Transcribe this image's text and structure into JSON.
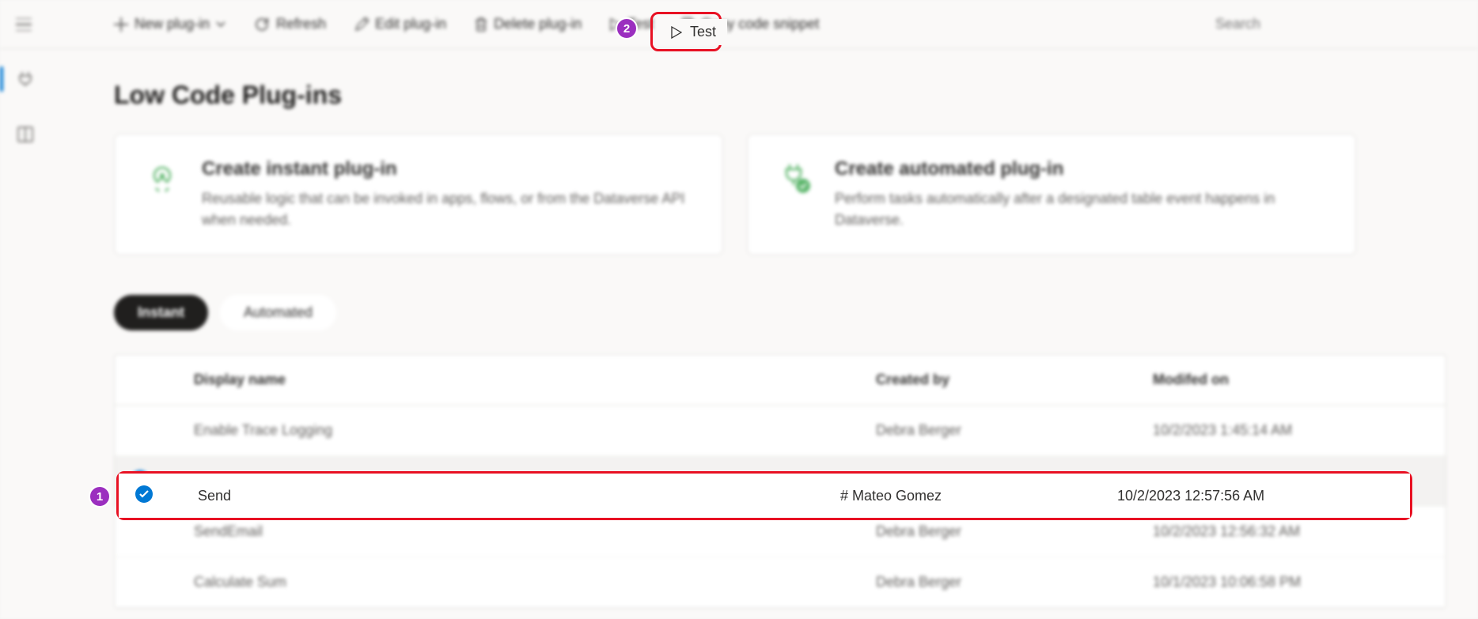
{
  "toolbar": {
    "new_plugin": "New plug-in",
    "refresh": "Refresh",
    "edit": "Edit plug-in",
    "delete": "Delete plug-in",
    "test": "Test",
    "copy": "Copy code snippet"
  },
  "search": {
    "placeholder": "Search"
  },
  "page": {
    "title": "Low Code Plug-ins"
  },
  "cards": {
    "instant": {
      "title": "Create instant plug-in",
      "desc": "Reusable logic that can be invoked in apps, flows, or from the Dataverse API when needed."
    },
    "automated": {
      "title": "Create automated plug-in",
      "desc": "Perform tasks automatically after a designated table event happens in Dataverse."
    }
  },
  "tabs": {
    "instant": "Instant",
    "automated": "Automated"
  },
  "table": {
    "headers": {
      "display_name": "Display name",
      "created_by": "Created by",
      "modified_on": "Modifed on"
    },
    "rows": [
      {
        "name": "Enable Trace Logging",
        "created_by": "Debra Berger",
        "modified_on": "10/2/2023 1:45:14 AM",
        "selected": false
      },
      {
        "name": "Send",
        "created_by": "# Mateo Gomez",
        "modified_on": "10/2/2023 12:57:56 AM",
        "selected": true
      },
      {
        "name": "SendEmail",
        "created_by": "Debra Berger",
        "modified_on": "10/2/2023 12:56:32 AM",
        "selected": false
      },
      {
        "name": "Calculate Sum",
        "created_by": "Debra Berger",
        "modified_on": "10/1/2023 10:06:58 PM",
        "selected": false
      }
    ]
  },
  "annotations": {
    "badge1": "1",
    "badge2": "2"
  }
}
